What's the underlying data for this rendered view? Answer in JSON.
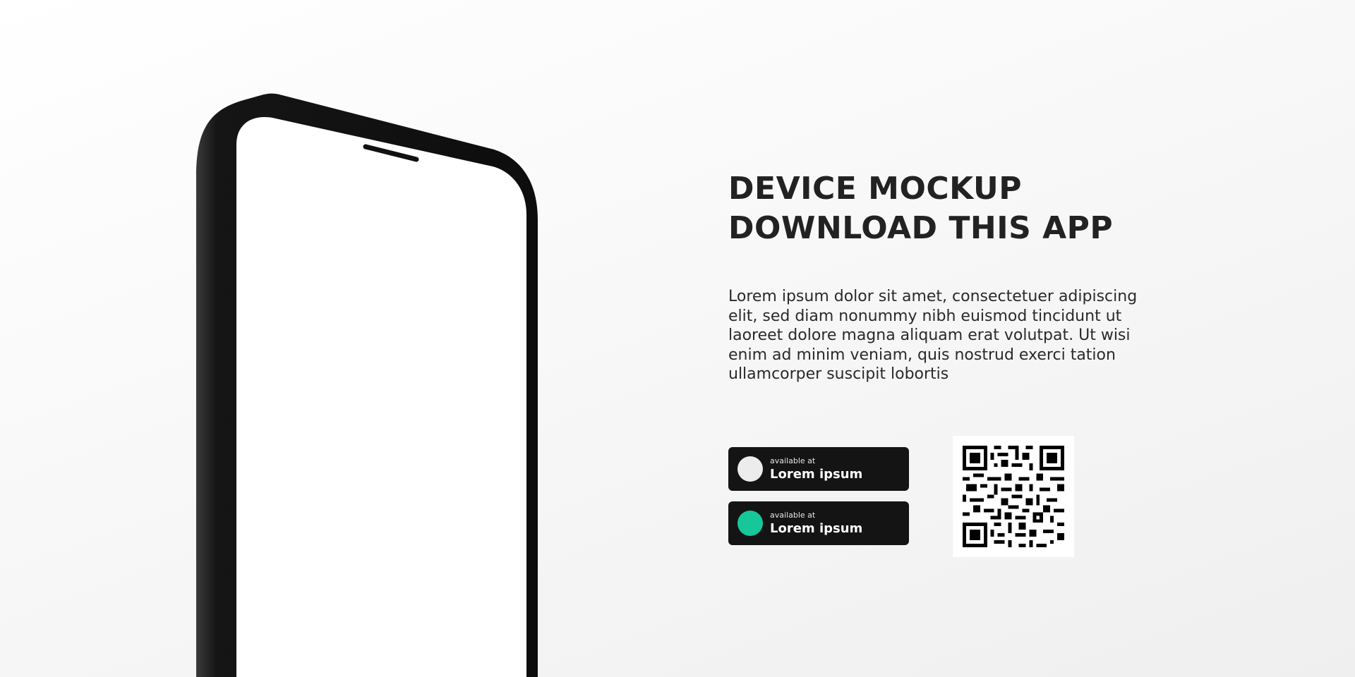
{
  "headline": {
    "line1": "DEVICE MOCKUP",
    "line2": "DOWNLOAD THIS APP"
  },
  "description": "Lorem ipsum dolor sit amet, consectetuer adipiscing elit, sed diam nonummy nibh euismod tincidunt ut laoreet dolore magna aliquam erat volutpat. Ut wisi enim ad minim veniam, quis nostrud exerci tation ullamcorper suscipit lobortis",
  "store_buttons": [
    {
      "small_label": "available at",
      "label": "Lorem ipsum",
      "icon_color": "#ececec"
    },
    {
      "small_label": "available at",
      "label": "Lorem ipsum",
      "icon_color": "#16c79a"
    }
  ],
  "colors": {
    "phone_frame": "#111111",
    "button_background": "#141414",
    "heading_text": "#222222"
  },
  "icons": {
    "qr": "qr-code-icon",
    "phone": "smartphone-mockup"
  }
}
